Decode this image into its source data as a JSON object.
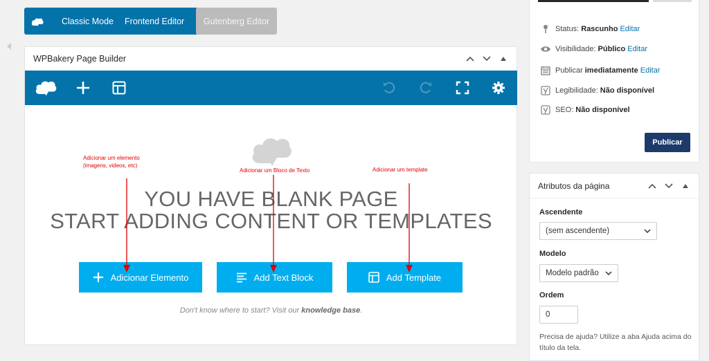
{
  "modes": {
    "classic": "Classic Mode",
    "frontend": "Frontend Editor",
    "gutenberg": "Gutenberg Editor"
  },
  "builder": {
    "title": "WPBakery Page Builder",
    "blank_line1": "YOU HAVE BLANK PAGE",
    "blank_line2": "START ADDING CONTENT OR TEMPLATES",
    "buttons": {
      "add_element": "Adicionar Elemento",
      "add_text_block": "Add Text Block",
      "add_template": "Add Template"
    },
    "help_prefix": "Don't know where to start? Visit our",
    "help_link": "knowledge base",
    "help_suffix": "."
  },
  "annotations": {
    "element_line1": "Adicionar um elemento",
    "element_line2": "(imagens, videos, etc)",
    "text_block": "Adicionar um Bloco de Texto",
    "template": "Adicionar um template"
  },
  "publish": {
    "status_label": "Status:",
    "status_value": "Rascunho",
    "status_edit": "Editar",
    "visibility_label": "Visibilidade:",
    "visibility_value": "Público",
    "visibility_edit": "Editar",
    "publish_label": "Publicar",
    "publish_value": "imediatamente",
    "publish_edit": "Editar",
    "readability_label": "Legibilidade:",
    "readability_value": "Não disponível",
    "seo_label": "SEO:",
    "seo_value": "Não disponível",
    "publish_button": "Publicar"
  },
  "page_attributes": {
    "title": "Atributos da página",
    "parent_label": "Ascendente",
    "parent_value": "(sem ascendente)",
    "template_label": "Modelo",
    "template_value": "Modelo padrão",
    "order_label": "Ordem",
    "order_value": "0",
    "help": "Precisa de ajuda? Utilize a aba Ajuda acima do título da tela."
  },
  "colors": {
    "toolbar_blue": "#0473aa",
    "button_cyan": "#00aef0",
    "annotation_red": "#e20000",
    "publish_navy": "#1c3b6b"
  }
}
